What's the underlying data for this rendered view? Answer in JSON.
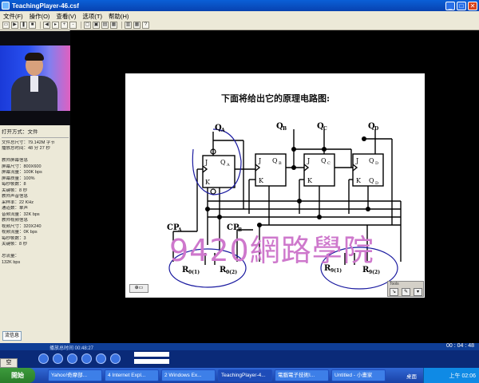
{
  "window": {
    "title": "TeachingPlayer-46.csf"
  },
  "menu": [
    "文件(F)",
    "操作(O)",
    "查看(V)",
    "选项(T)",
    "帮助(H)"
  ],
  "info_panel": {
    "header": "打开方式：文件",
    "rows": [
      "文件总尺寸：79.142M 字节",
      "播放总时间：48 分 27 秒",
      "",
      "教师屏幕信息",
      "  屏幕尺寸：800X600",
      "  屏幕流量：100K bps",
      "  屏幕质量：100%",
      "  每秒帧数：8",
      "  关键帧：8 秒",
      "教师声音信息",
      "  采样率：22 KHz",
      "  通道数：单声",
      "  音频流量：32K bps",
      "教师视频信息",
      "  视频尺寸：320X240",
      "  视频流量：0K bps",
      "  每秒帧数：3",
      "  关键帧：8 秒",
      "",
      "总流量：",
      "  132K bps"
    ],
    "tab_label": "流信息"
  },
  "slide": {
    "heading": "下面将给出它的原理电路图:",
    "circuit_labels": {
      "qa": "Q",
      "qa_sub": "A",
      "qb": "Q",
      "qb_sub": "B",
      "qc": "Q",
      "qc_sub": "C",
      "qd": "Q",
      "qd_sub": "D",
      "cpa": "CP",
      "cpa_sub": "A",
      "cpb": "CP",
      "cpb_sub": "B",
      "r01": "R",
      "r01_sub": "0(1)",
      "r02": "R",
      "r02_sub": "0(2)",
      "r91": "R",
      "r91_sub": "9(1)",
      "r92": "R",
      "r92_sub": "9(2)"
    },
    "tools_label": "Tools"
  },
  "watermark": "9420網路學院",
  "status": {
    "elapsed": "播放总时间 00:48:27",
    "remaining": "00 : 04 : 48"
  },
  "taskbar": {
    "start": "開始",
    "ime": "空",
    "tasks": [
      "Yahoo!奇摩部...",
      "4 Internet Expl...",
      "2 Windows Ex...",
      "TeachingPlayer-4...",
      "電腦電子技術I...",
      "Untitled - 小畫家"
    ],
    "tray_label": "桌面",
    "clock": "上午 02:06"
  },
  "colors": {
    "title_bar": "#0a5fd6",
    "watermark": "#ce78cc",
    "annotation_ink": "#1a1aa0"
  }
}
